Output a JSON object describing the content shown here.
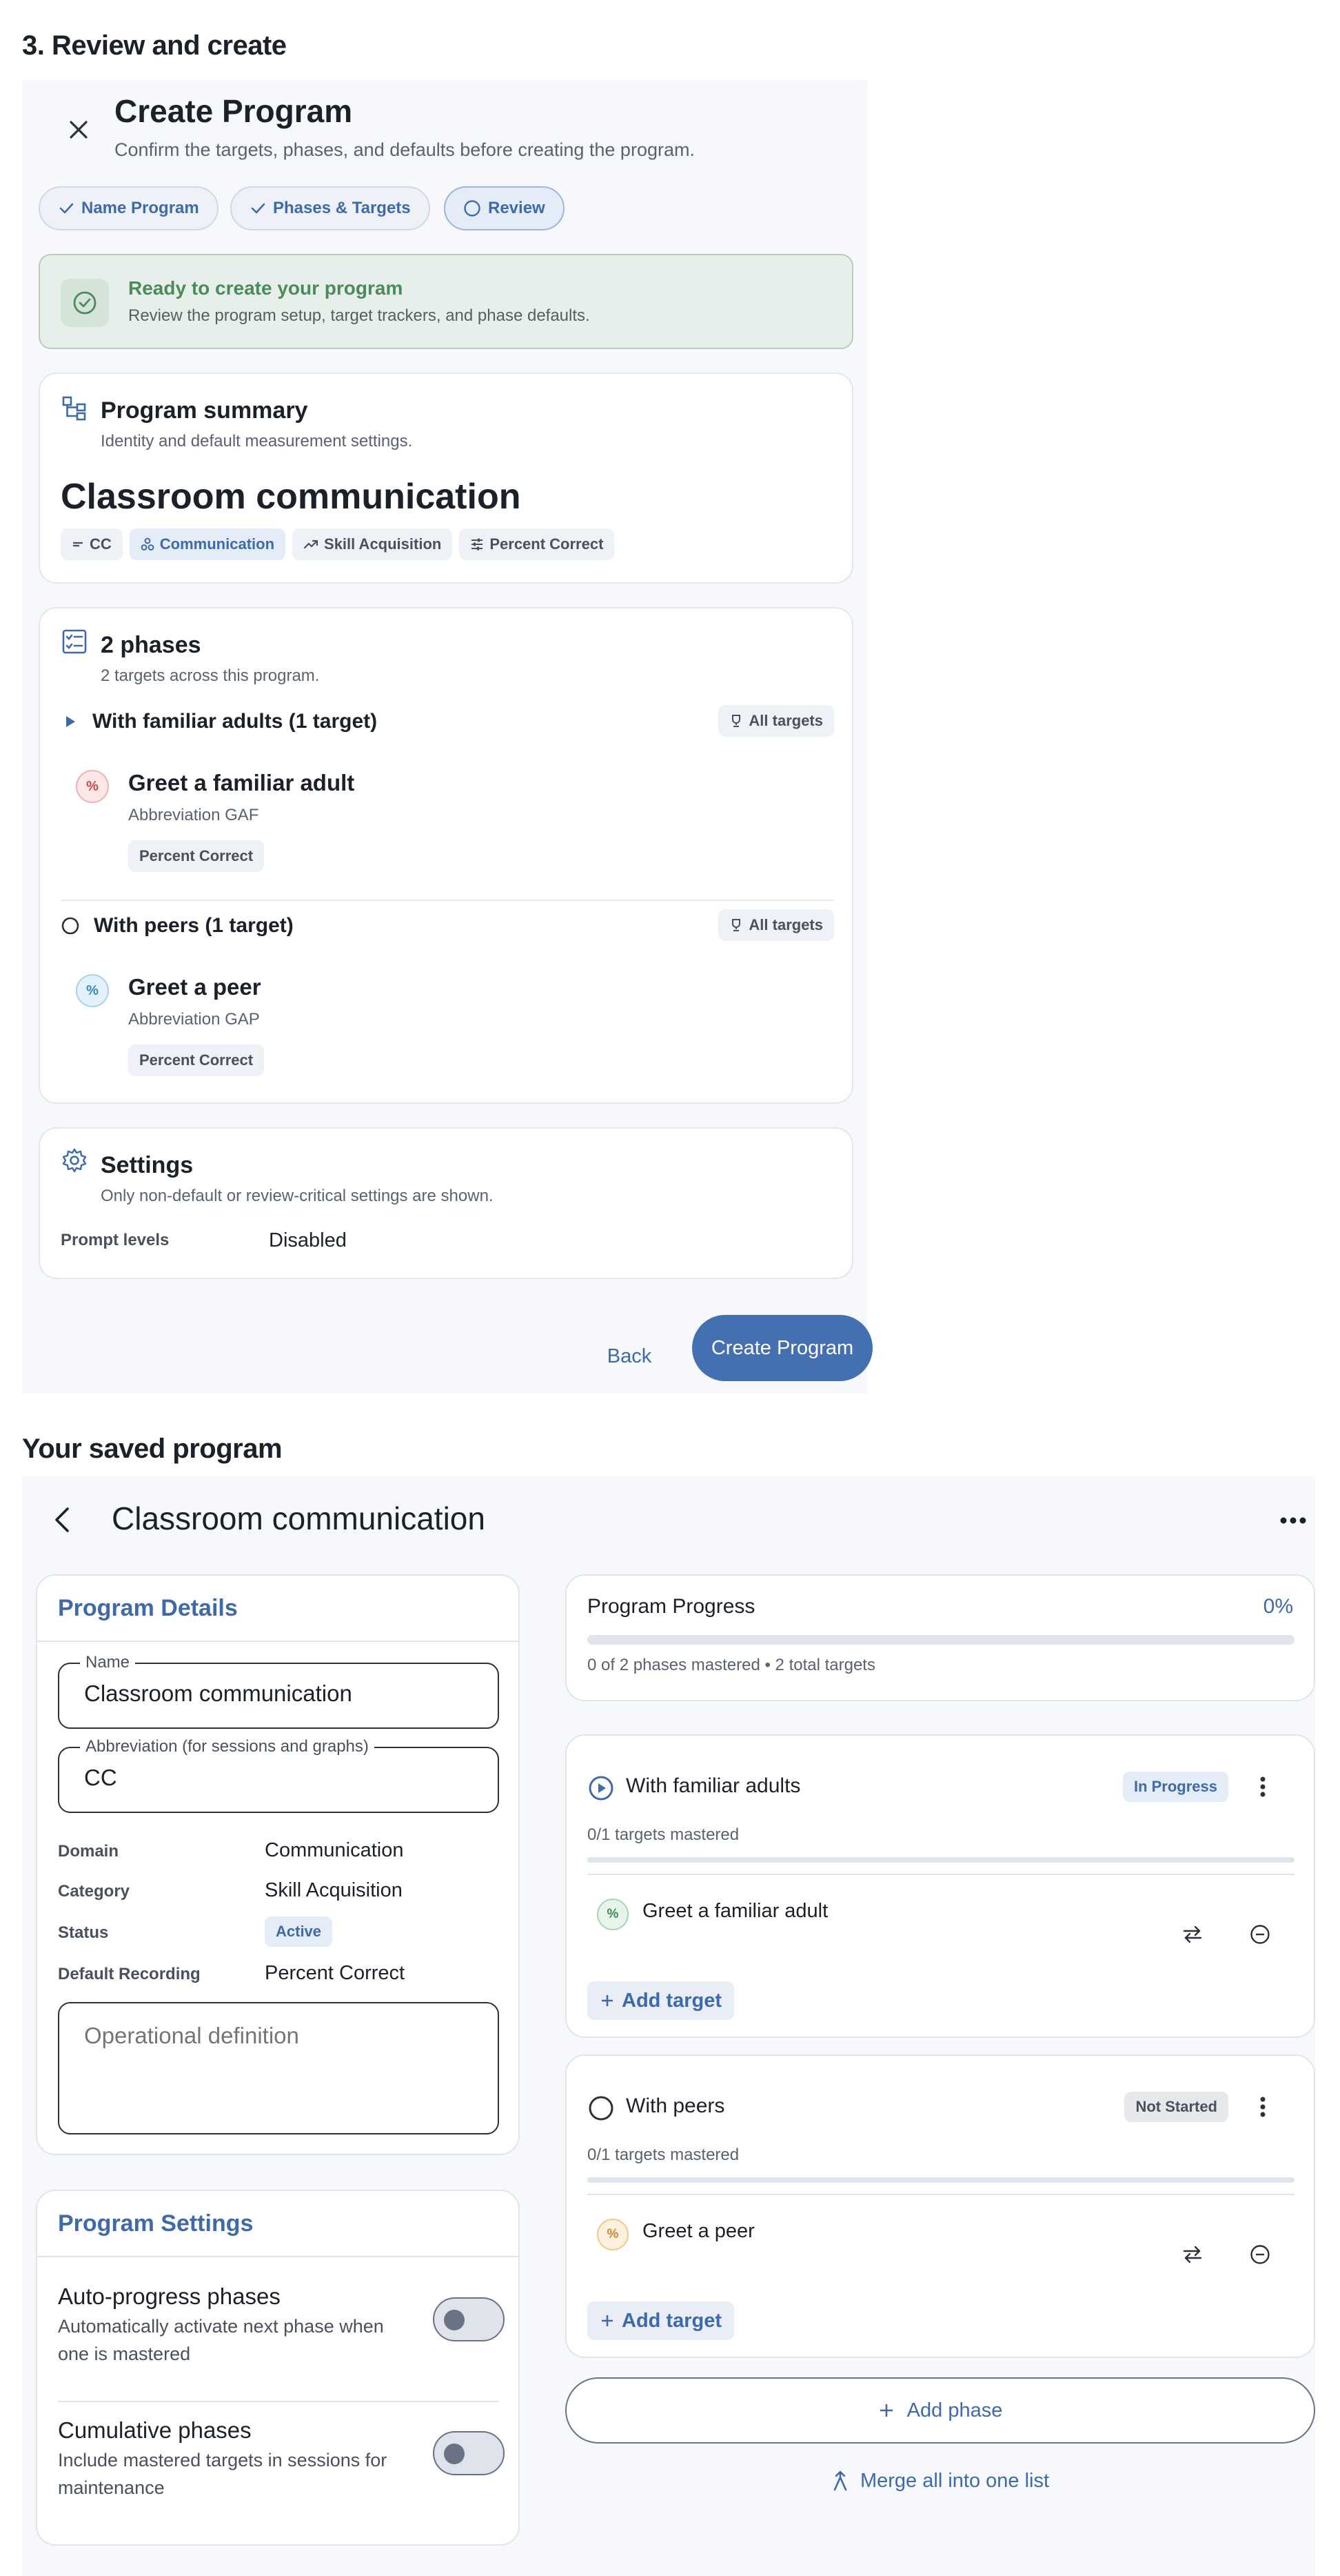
{
  "sections": {
    "review_title": "3. Review and create",
    "saved_title": "Your saved program"
  },
  "dialog": {
    "title": "Create Program",
    "subtitle": "Confirm the targets, phases, and defaults before creating the program.",
    "steps": [
      {
        "label": "Name Program",
        "state": "done"
      },
      {
        "label": "Phases & Targets",
        "state": "done"
      },
      {
        "label": "Review",
        "state": "current"
      }
    ],
    "ready": {
      "title": "Ready to create your program",
      "text": "Review the program setup, target trackers, and phase defaults."
    },
    "summary": {
      "title": "Program summary",
      "subtitle": "Identity and default measurement settings.",
      "name": "Classroom communication",
      "chips": [
        "CC",
        "Communication",
        "Skill Acquisition",
        "Percent Correct"
      ]
    },
    "phases": {
      "title": "2 phases",
      "subtitle": "2 targets across this program.",
      "items": [
        {
          "label": "With familiar adults (1 target)",
          "scope": "All targets",
          "target": {
            "name": "Greet a familiar adult",
            "abbr": "Abbreviation GAF",
            "method": "Percent Correct"
          }
        },
        {
          "label": "With peers (1 target)",
          "scope": "All targets",
          "target": {
            "name": "Greet a peer",
            "abbr": "Abbreviation GAP",
            "method": "Percent Correct"
          }
        }
      ]
    },
    "settings": {
      "title": "Settings",
      "subtitle": "Only non-default or review-critical settings are shown.",
      "prompt_key": "Prompt levels",
      "prompt_val": "Disabled"
    },
    "back_label": "Back",
    "create_label": "Create Program"
  },
  "saved": {
    "title": "Classroom communication",
    "details": {
      "heading": "Program Details",
      "name_legend": "Name",
      "name_value": "Classroom communication",
      "abbr_legend": "Abbreviation (for sessions and graphs)",
      "abbr_value": "CC",
      "domain_k": "Domain",
      "domain_v": "Communication",
      "category_k": "Category",
      "category_v": "Skill Acquisition",
      "status_k": "Status",
      "status_v": "Active",
      "recording_k": "Default Recording",
      "recording_v": "Percent Correct",
      "opdef_placeholder": "Operational definition"
    },
    "settings": {
      "heading": "Program Settings",
      "auto_title": "Auto-progress phases",
      "auto_desc": "Automatically activate next phase when one is mastered",
      "auto_on": false,
      "cum_title": "Cumulative phases",
      "cum_desc": "Include mastered targets in sessions for maintenance",
      "cum_on": false
    },
    "progress": {
      "label": "Program Progress",
      "percent": "0%",
      "value": 0,
      "summary": "0 of 2 phases mastered • 2 total targets"
    },
    "phases": [
      {
        "name": "With familiar adults",
        "status": "In Progress",
        "mastered_text": "0/1 targets mastered",
        "mastered_value": 0,
        "target": "Greet a familiar adult",
        "add_label": "Add target"
      },
      {
        "name": "With peers",
        "status": "Not Started",
        "mastered_text": "0/1 targets mastered",
        "mastered_value": 0,
        "target": "Greet a peer",
        "add_label": "Add target"
      }
    ],
    "add_phase_label": "Add phase",
    "merge_label": "Merge all into one list"
  },
  "colors": {
    "accent": "#4470b2",
    "success": "#4c8a5c",
    "in_progress_bg": "#e4ecf8",
    "not_started_bg": "#e6e8ec"
  }
}
